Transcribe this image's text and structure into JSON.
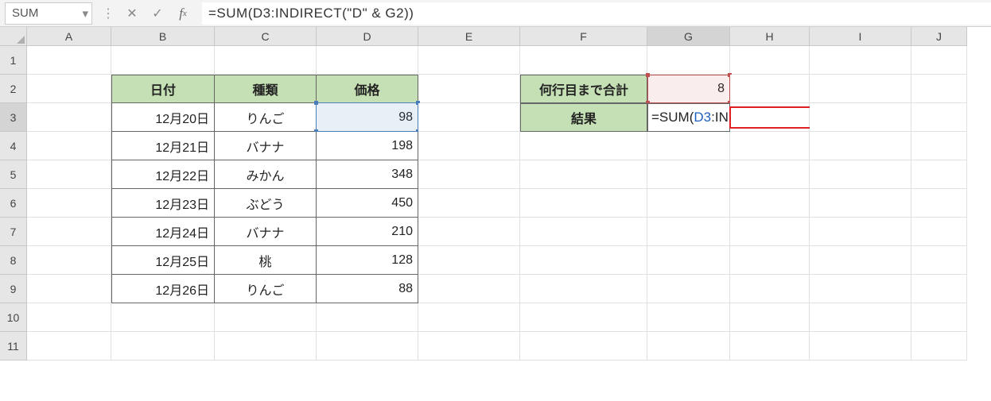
{
  "formula_bar": {
    "name_box": "SUM",
    "formula": "=SUM(D3:INDIRECT(\"D\" & G2))"
  },
  "columns": [
    "A",
    "B",
    "C",
    "D",
    "E",
    "F",
    "G",
    "H",
    "I",
    "J"
  ],
  "rows": [
    "1",
    "2",
    "3",
    "4",
    "5",
    "6",
    "7",
    "8",
    "9",
    "10",
    "11"
  ],
  "table1": {
    "headers": {
      "b": "日付",
      "c": "種類",
      "d": "価格"
    },
    "rows": [
      {
        "b": "12月20日",
        "c": "りんご",
        "d": "98"
      },
      {
        "b": "12月21日",
        "c": "バナナ",
        "d": "198"
      },
      {
        "b": "12月22日",
        "c": "みかん",
        "d": "348"
      },
      {
        "b": "12月23日",
        "c": "ぶどう",
        "d": "450"
      },
      {
        "b": "12月24日",
        "c": "バナナ",
        "d": "210"
      },
      {
        "b": "12月25日",
        "c": "桃",
        "d": "128"
      },
      {
        "b": "12月26日",
        "c": "りんご",
        "d": "88"
      }
    ]
  },
  "side": {
    "f2": "何行目まで合計",
    "g2": "8",
    "f3": "結果"
  },
  "g3_formula": {
    "p1": "=SUM(",
    "p2": "D3",
    "p3": ":",
    "p4": "INDIRECT(\"D\" & ",
    "p5": "G2",
    "p6": "))"
  }
}
